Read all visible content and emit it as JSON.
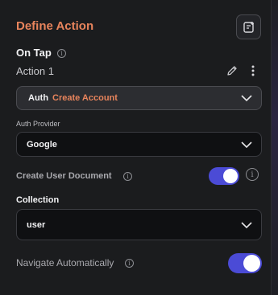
{
  "header": {
    "title": "Define Action"
  },
  "trigger": {
    "label": "On Tap",
    "action_name": "Action 1"
  },
  "action_select": {
    "category": "Auth",
    "value": "Create Account"
  },
  "auth_provider": {
    "label": "Auth Provider",
    "value": "Google"
  },
  "create_user_document": {
    "label": "Create User Document",
    "enabled": true
  },
  "collection": {
    "label": "Collection",
    "value": "user"
  },
  "navigate_automatically": {
    "label": "Navigate Automatically",
    "enabled": true
  },
  "colors": {
    "accent": "#e8845c",
    "toggle": "#4b4bd6",
    "background": "#1b1c1e"
  }
}
